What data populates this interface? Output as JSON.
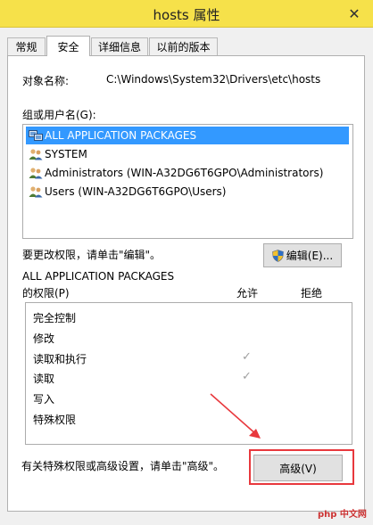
{
  "window": {
    "title": "hosts 属性",
    "close_glyph": "✕"
  },
  "tabs": [
    {
      "label": "常规"
    },
    {
      "label": "安全"
    },
    {
      "label": "详细信息"
    },
    {
      "label": "以前的版本"
    }
  ],
  "object": {
    "label": "对象名称:",
    "value": "C:\\Windows\\System32\\Drivers\\etc\\hosts"
  },
  "groups": {
    "label": "组或用户名(G):",
    "items": [
      {
        "label": "ALL APPLICATION PACKAGES",
        "icon": "packages-icon",
        "selected": true
      },
      {
        "label": "SYSTEM",
        "icon": "users-icon"
      },
      {
        "label": "Administrators (WIN-A32DG6T6GPO\\Administrators)",
        "icon": "users-icon"
      },
      {
        "label": "Users (WIN-A32DG6T6GPO\\Users)",
        "icon": "users-icon"
      }
    ]
  },
  "edit": {
    "hint": "要更改权限，请单击\"编辑\"。",
    "button": "编辑(E)..."
  },
  "permissions": {
    "title_line1": "ALL APPLICATION PACKAGES",
    "title_line2": "的权限(P)",
    "col_allow": "允许",
    "col_deny": "拒绝",
    "rows": [
      {
        "label": "完全控制",
        "allow": false
      },
      {
        "label": "修改",
        "allow": false
      },
      {
        "label": "读取和执行",
        "allow": true
      },
      {
        "label": "读取",
        "allow": true
      },
      {
        "label": "写入",
        "allow": false
      },
      {
        "label": "特殊权限",
        "allow": false
      }
    ],
    "check_glyph": "✓"
  },
  "advanced": {
    "hint": "有关特殊权限或高级设置，请单击\"高级\"。",
    "button": "高级(V)"
  },
  "watermark": "php 中文网",
  "colors": {
    "titlebar": "#f6e14a",
    "selection": "#3399ff",
    "annotation": "#e8383d"
  }
}
